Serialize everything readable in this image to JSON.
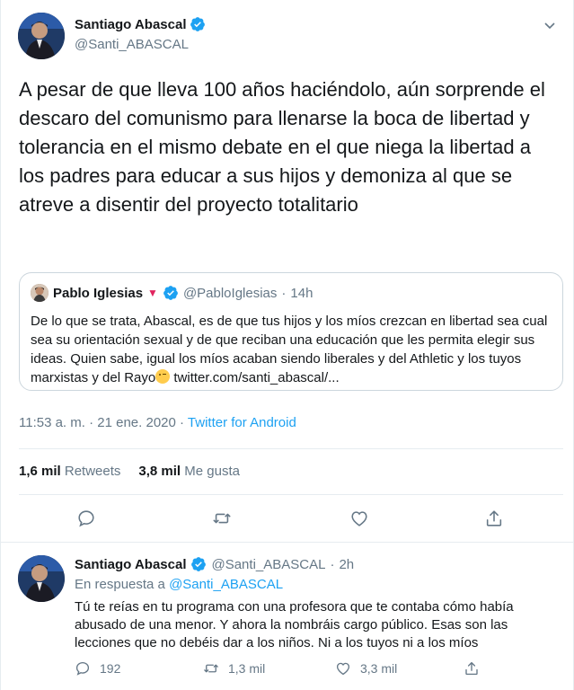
{
  "main_tweet": {
    "author_name": "Santiago Abascal",
    "author_handle": "@Santi_ABASCAL",
    "text": "A pesar de que lleva 100 años haciéndolo, aún sorprende el descaro del comunismo para llenarse la boca de libertad y tolerancia en el mismo debate en el que niega la libertad a los padres para educar a sus hijos y demoniza al que se atreve a disentir del proyecto totalitario",
    "quoted": {
      "author_name": "Pablo Iglesias",
      "flag_glyph": "▼",
      "author_handle": "@PabloIglesias",
      "separator": "·",
      "time": "14h",
      "text_before_emoji": "De lo que se trata, Abascal, es de que tus hijos y los míos crezcan en libertad sea cual sea su orientación sexual y de que reciban una educación que les permita elegir sus ideas. Quien sabe, igual los míos acaban siendo liberales y del Athletic y los tuyos marxistas y del Rayo",
      "link": " twitter.com/santi_abascal/..."
    },
    "timestamp": "11:53 a. m. · 21 ene. 2020 · ",
    "source": "Twitter for Android",
    "retweets_count": "1,6 mil",
    "retweets_label": " Retweets",
    "likes_count": "3,8 mil",
    "likes_label": " Me gusta"
  },
  "reply_tweet": {
    "author_name": "Santiago Abascal",
    "author_handle": "@Santi_ABASCAL",
    "separator": "·",
    "time": "2h",
    "reply_prefix": "En respuesta a ",
    "reply_to_handle": "@Santi_ABASCAL",
    "text": "Tú te reías en tu programa con una profesora que te contaba cómo había abusado de una menor. Y ahora la nombráis cargo público. Esas son las lecciones que no debéis dar a los niños. Ni a los tuyos ni a los míos",
    "replies": "192",
    "retweets": "1,3 mil",
    "likes": "3,3 mil"
  },
  "icons": {
    "verified": "verified-badge-icon",
    "caret": "chevron-down-icon",
    "reply": "reply-icon",
    "retweet": "retweet-icon",
    "like": "heart-icon",
    "share": "share-icon"
  },
  "colors": {
    "accent": "#1da1f2",
    "secondary_text": "#657786",
    "border": "#e6ecf0"
  }
}
